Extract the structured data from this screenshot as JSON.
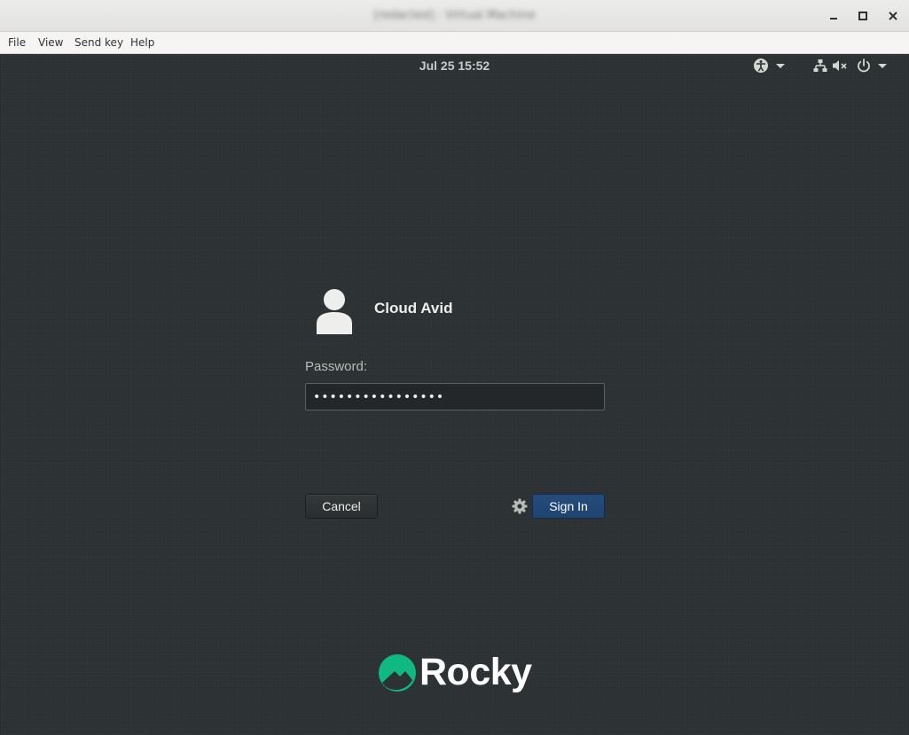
{
  "window": {
    "title": "[redacted] - Virtual Machine",
    "controls": {
      "minimize": "minimize-icon",
      "maximize": "maximize-icon",
      "close": "close-icon"
    }
  },
  "menubar": {
    "items": [
      "File",
      "View",
      "Send key",
      "Help"
    ]
  },
  "topbar": {
    "clock": "Jul 25  15:52",
    "icons": [
      "accessibility-icon",
      "network-wired-icon",
      "volume-muted-icon",
      "power-icon"
    ]
  },
  "login": {
    "user_name": "Cloud Avid",
    "password_label": "Password:",
    "password_value": "••••••••••••••••",
    "cancel_label": "Cancel",
    "signin_label": "Sign In",
    "session_icon": "gear-icon"
  },
  "branding": {
    "logo_text": "Rocky",
    "logo_color": "#10b981"
  },
  "colors": {
    "background": "#2c3133",
    "accent": "#1f4470",
    "text": "#eeeeec"
  }
}
